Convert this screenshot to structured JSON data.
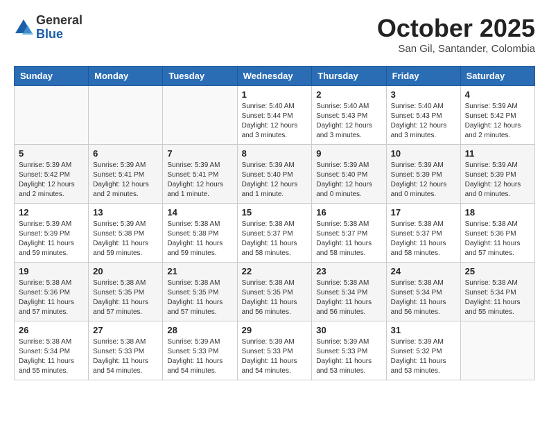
{
  "logo": {
    "general": "General",
    "blue": "Blue"
  },
  "header": {
    "month": "October 2025",
    "location": "San Gil, Santander, Colombia"
  },
  "weekdays": [
    "Sunday",
    "Monday",
    "Tuesday",
    "Wednesday",
    "Thursday",
    "Friday",
    "Saturday"
  ],
  "weeks": [
    [
      {
        "day": "",
        "info": ""
      },
      {
        "day": "",
        "info": ""
      },
      {
        "day": "",
        "info": ""
      },
      {
        "day": "1",
        "info": "Sunrise: 5:40 AM\nSunset: 5:44 PM\nDaylight: 12 hours\nand 3 minutes."
      },
      {
        "day": "2",
        "info": "Sunrise: 5:40 AM\nSunset: 5:43 PM\nDaylight: 12 hours\nand 3 minutes."
      },
      {
        "day": "3",
        "info": "Sunrise: 5:40 AM\nSunset: 5:43 PM\nDaylight: 12 hours\nand 3 minutes."
      },
      {
        "day": "4",
        "info": "Sunrise: 5:39 AM\nSunset: 5:42 PM\nDaylight: 12 hours\nand 2 minutes."
      }
    ],
    [
      {
        "day": "5",
        "info": "Sunrise: 5:39 AM\nSunset: 5:42 PM\nDaylight: 12 hours\nand 2 minutes."
      },
      {
        "day": "6",
        "info": "Sunrise: 5:39 AM\nSunset: 5:41 PM\nDaylight: 12 hours\nand 2 minutes."
      },
      {
        "day": "7",
        "info": "Sunrise: 5:39 AM\nSunset: 5:41 PM\nDaylight: 12 hours\nand 1 minute."
      },
      {
        "day": "8",
        "info": "Sunrise: 5:39 AM\nSunset: 5:40 PM\nDaylight: 12 hours\nand 1 minute."
      },
      {
        "day": "9",
        "info": "Sunrise: 5:39 AM\nSunset: 5:40 PM\nDaylight: 12 hours\nand 0 minutes."
      },
      {
        "day": "10",
        "info": "Sunrise: 5:39 AM\nSunset: 5:39 PM\nDaylight: 12 hours\nand 0 minutes."
      },
      {
        "day": "11",
        "info": "Sunrise: 5:39 AM\nSunset: 5:39 PM\nDaylight: 12 hours\nand 0 minutes."
      }
    ],
    [
      {
        "day": "12",
        "info": "Sunrise: 5:39 AM\nSunset: 5:39 PM\nDaylight: 11 hours\nand 59 minutes."
      },
      {
        "day": "13",
        "info": "Sunrise: 5:39 AM\nSunset: 5:38 PM\nDaylight: 11 hours\nand 59 minutes."
      },
      {
        "day": "14",
        "info": "Sunrise: 5:38 AM\nSunset: 5:38 PM\nDaylight: 11 hours\nand 59 minutes."
      },
      {
        "day": "15",
        "info": "Sunrise: 5:38 AM\nSunset: 5:37 PM\nDaylight: 11 hours\nand 58 minutes."
      },
      {
        "day": "16",
        "info": "Sunrise: 5:38 AM\nSunset: 5:37 PM\nDaylight: 11 hours\nand 58 minutes."
      },
      {
        "day": "17",
        "info": "Sunrise: 5:38 AM\nSunset: 5:37 PM\nDaylight: 11 hours\nand 58 minutes."
      },
      {
        "day": "18",
        "info": "Sunrise: 5:38 AM\nSunset: 5:36 PM\nDaylight: 11 hours\nand 57 minutes."
      }
    ],
    [
      {
        "day": "19",
        "info": "Sunrise: 5:38 AM\nSunset: 5:36 PM\nDaylight: 11 hours\nand 57 minutes."
      },
      {
        "day": "20",
        "info": "Sunrise: 5:38 AM\nSunset: 5:35 PM\nDaylight: 11 hours\nand 57 minutes."
      },
      {
        "day": "21",
        "info": "Sunrise: 5:38 AM\nSunset: 5:35 PM\nDaylight: 11 hours\nand 57 minutes."
      },
      {
        "day": "22",
        "info": "Sunrise: 5:38 AM\nSunset: 5:35 PM\nDaylight: 11 hours\nand 56 minutes."
      },
      {
        "day": "23",
        "info": "Sunrise: 5:38 AM\nSunset: 5:34 PM\nDaylight: 11 hours\nand 56 minutes."
      },
      {
        "day": "24",
        "info": "Sunrise: 5:38 AM\nSunset: 5:34 PM\nDaylight: 11 hours\nand 56 minutes."
      },
      {
        "day": "25",
        "info": "Sunrise: 5:38 AM\nSunset: 5:34 PM\nDaylight: 11 hours\nand 55 minutes."
      }
    ],
    [
      {
        "day": "26",
        "info": "Sunrise: 5:38 AM\nSunset: 5:34 PM\nDaylight: 11 hours\nand 55 minutes."
      },
      {
        "day": "27",
        "info": "Sunrise: 5:38 AM\nSunset: 5:33 PM\nDaylight: 11 hours\nand 54 minutes."
      },
      {
        "day": "28",
        "info": "Sunrise: 5:39 AM\nSunset: 5:33 PM\nDaylight: 11 hours\nand 54 minutes."
      },
      {
        "day": "29",
        "info": "Sunrise: 5:39 AM\nSunset: 5:33 PM\nDaylight: 11 hours\nand 54 minutes."
      },
      {
        "day": "30",
        "info": "Sunrise: 5:39 AM\nSunset: 5:33 PM\nDaylight: 11 hours\nand 53 minutes."
      },
      {
        "day": "31",
        "info": "Sunrise: 5:39 AM\nSunset: 5:32 PM\nDaylight: 11 hours\nand 53 minutes."
      },
      {
        "day": "",
        "info": ""
      }
    ]
  ]
}
